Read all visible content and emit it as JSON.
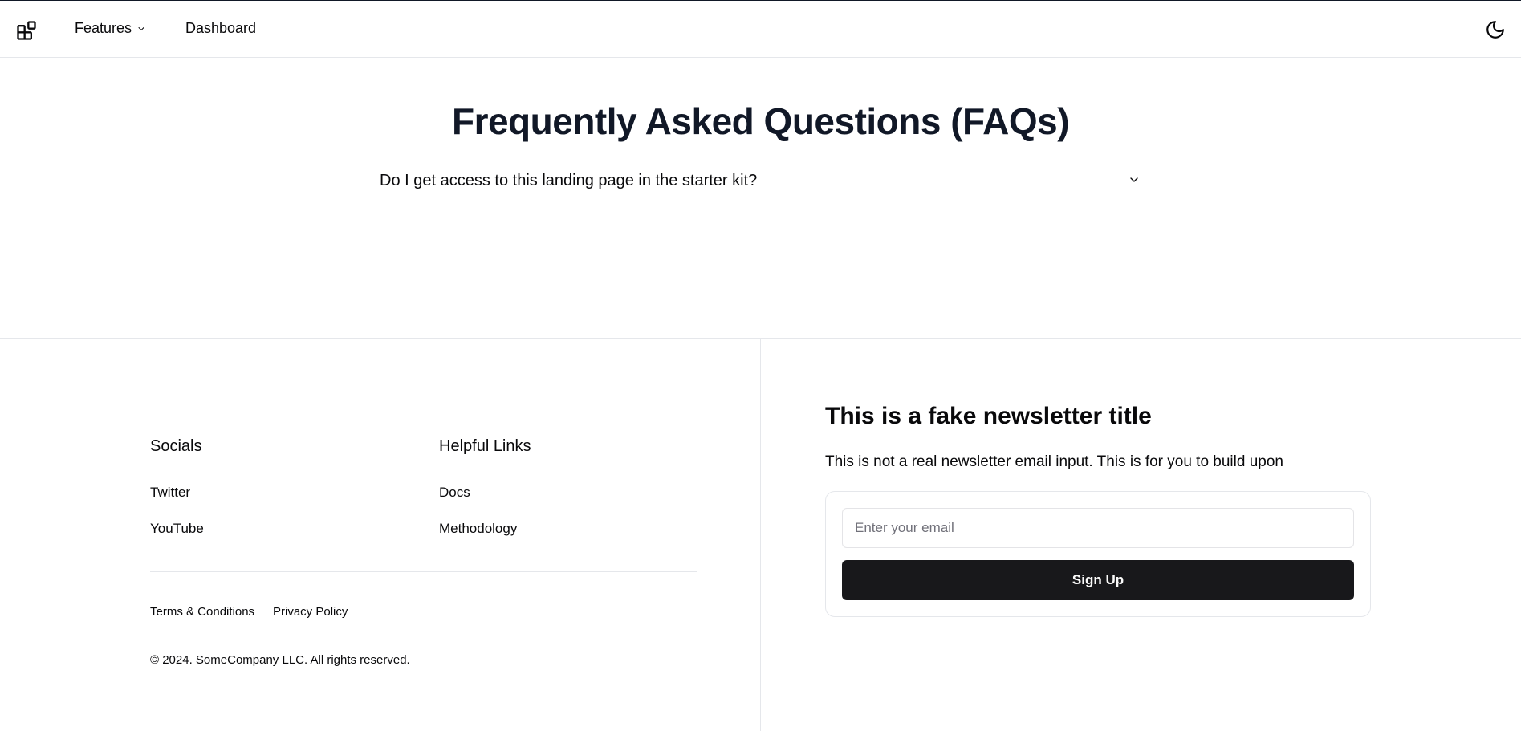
{
  "nav": {
    "logo_icon": "blocks-icon",
    "features_label": "Features",
    "dashboard_label": "Dashboard",
    "theme_icon": "moon-icon"
  },
  "faq": {
    "title": "Frequently Asked Questions (FAQs)",
    "items": [
      {
        "question": "Do I get access to this landing page in the starter kit?"
      }
    ]
  },
  "footer": {
    "socials_title": "Socials",
    "socials": [
      "Twitter",
      "YouTube"
    ],
    "links_title": "Helpful Links",
    "links": [
      "Docs",
      "Methodology"
    ],
    "legal": [
      "Terms & Conditions",
      "Privacy Policy"
    ],
    "copyright": "© 2024. SomeCompany LLC. All rights reserved."
  },
  "newsletter": {
    "title": "This is a fake newsletter title",
    "description": "This is not a real newsletter email input. This is for you to build upon",
    "email_placeholder": "Enter your email",
    "email_value": "",
    "signup_label": "Sign Up"
  },
  "colors": {
    "primary_button": "#18181b",
    "border": "#e5e7eb",
    "text": "#09090b"
  }
}
